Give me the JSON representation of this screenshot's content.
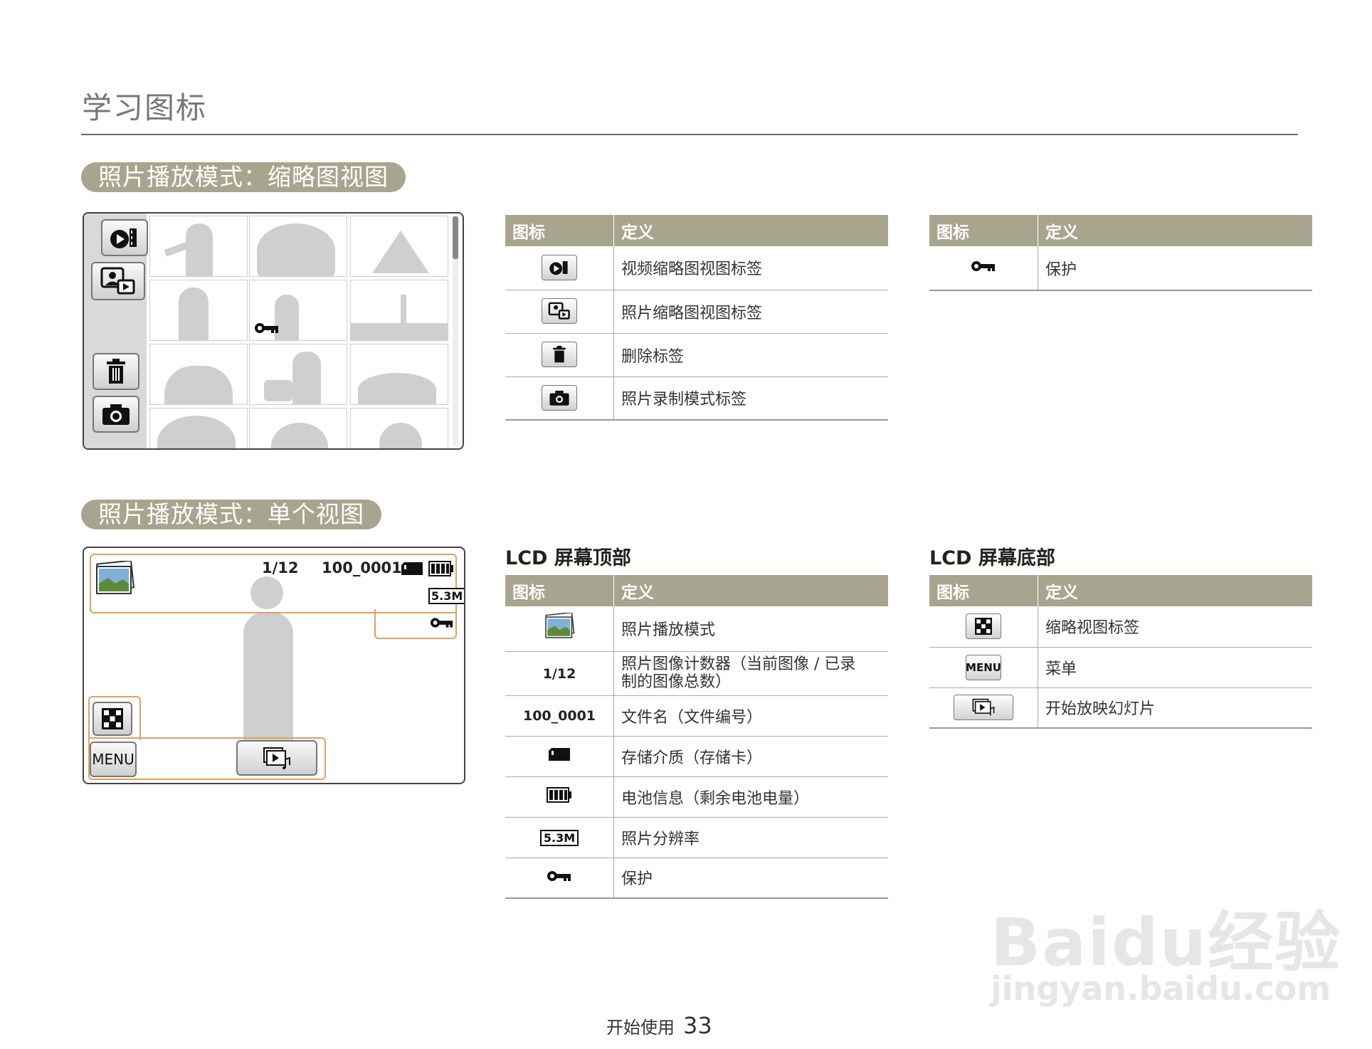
{
  "page": {
    "title": "学习图标",
    "footer_label": "开始使用",
    "page_number": "33"
  },
  "section_thumbnail": {
    "title": "照片播放模式：缩略图视图",
    "table": {
      "headers": [
        "图标",
        "定义"
      ],
      "rows": [
        {
          "icon": "video-thumbnail-tab-icon",
          "definition": "视频缩略图视图标签"
        },
        {
          "icon": "photo-thumbnail-tab-icon",
          "definition": "照片缩略图视图标签"
        },
        {
          "icon": "trash-icon",
          "definition": "删除标签"
        },
        {
          "icon": "camera-icon",
          "definition": "照片录制模式标签"
        }
      ]
    },
    "table_right": {
      "headers": [
        "图标",
        "定义"
      ],
      "rows": [
        {
          "icon": "key-icon",
          "definition": "保护"
        }
      ]
    }
  },
  "section_single": {
    "title": "照片播放模式：单个视图",
    "screen": {
      "counter": "1/12",
      "filename": "100_0001",
      "resolution": "5.3M",
      "menu_label": "MENU"
    },
    "top_table": {
      "heading": "LCD 屏幕顶部",
      "headers": [
        "图标",
        "定义"
      ],
      "rows": [
        {
          "icon": "photo-playback-icon",
          "definition": "照片播放模式"
        },
        {
          "icon_text": "1/12",
          "definition_line1": "照片图像计数器（当前图像 / 已录",
          "definition_line2": "制的图像总数）"
        },
        {
          "icon_text": "100_0001",
          "definition": "文件名（文件编号）"
        },
        {
          "icon": "storage-card-icon",
          "definition": "存储介质（存储卡）"
        },
        {
          "icon": "battery-icon",
          "definition": "电池信息（剩余电池电量）"
        },
        {
          "icon": "resolution-icon",
          "definition": "照片分辨率"
        },
        {
          "icon": "key-icon",
          "definition": "保护"
        }
      ]
    },
    "bottom_table": {
      "heading": "LCD 屏幕底部",
      "headers": [
        "图标",
        "定义"
      ],
      "rows": [
        {
          "icon": "thumbnail-view-icon",
          "definition": "缩略视图标签"
        },
        {
          "icon_text": "MENU",
          "definition": "菜单"
        },
        {
          "icon": "slideshow-icon",
          "definition": "开始放映幻灯片"
        }
      ]
    }
  },
  "watermark": {
    "brand": "Baidu经验",
    "url": "jingyan.baidu.com"
  }
}
